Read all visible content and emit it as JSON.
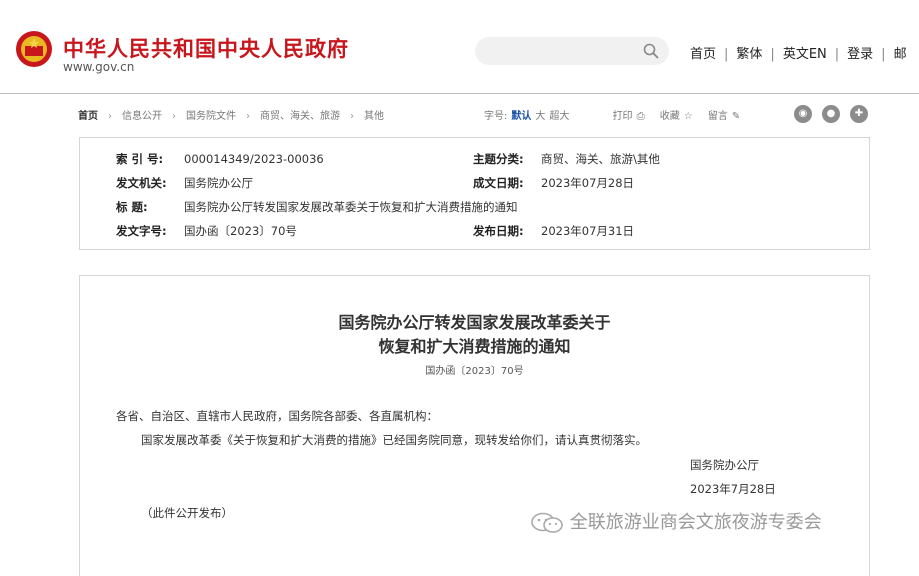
{
  "header": {
    "site_title": "中华人民共和国中央人民政府",
    "site_url": "www.gov.cn",
    "nav": [
      "首页",
      "繁体",
      "英文EN",
      "登录",
      "邮"
    ]
  },
  "breadcrumb": [
    "首页",
    "信息公开",
    "国务院文件",
    "商贸、海关、旅游",
    "其他"
  ],
  "tools": {
    "font_label": "字号:",
    "font_default": "默认",
    "font_large": "大",
    "font_xlarge": "超大",
    "print": "打印",
    "favorite": "收藏",
    "comment": "留言"
  },
  "info": {
    "index_label": "索 引 号:",
    "index_value": "000014349/2023-00036",
    "topic_label": "主题分类:",
    "topic_value": "商贸、海关、旅游\\其他",
    "issuer_label": "发文机关:",
    "issuer_value": "国务院办公厅",
    "written_label": "成文日期:",
    "written_value": "2023年07月28日",
    "title_label": "标      题:",
    "title_value": "国务院办公厅转发国家发展改革委关于恢复和扩大消费措施的通知",
    "docno_label": "发文字号:",
    "docno_value": "国办函〔2023〕70号",
    "publish_label": "发布日期:",
    "publish_value": "2023年07月31日"
  },
  "document": {
    "title_line1": "国务院办公厅转发国家发展改革委关于",
    "title_line2": "恢复和扩大消费措施的通知",
    "doc_no": "国办函〔2023〕70号",
    "recipients": "各省、自治区、直辖市人民政府，国务院各部委、各直属机构：",
    "body": "国家发展改革委《关于恢复和扩大消费的措施》已经国务院同意，现转发给你们，请认真贯彻落实。",
    "signature": "国务院办公厅",
    "date": "2023年7月28日",
    "note": "（此件公开发布）"
  },
  "watermark": "全联旅游业商会文旅夜游专委会"
}
